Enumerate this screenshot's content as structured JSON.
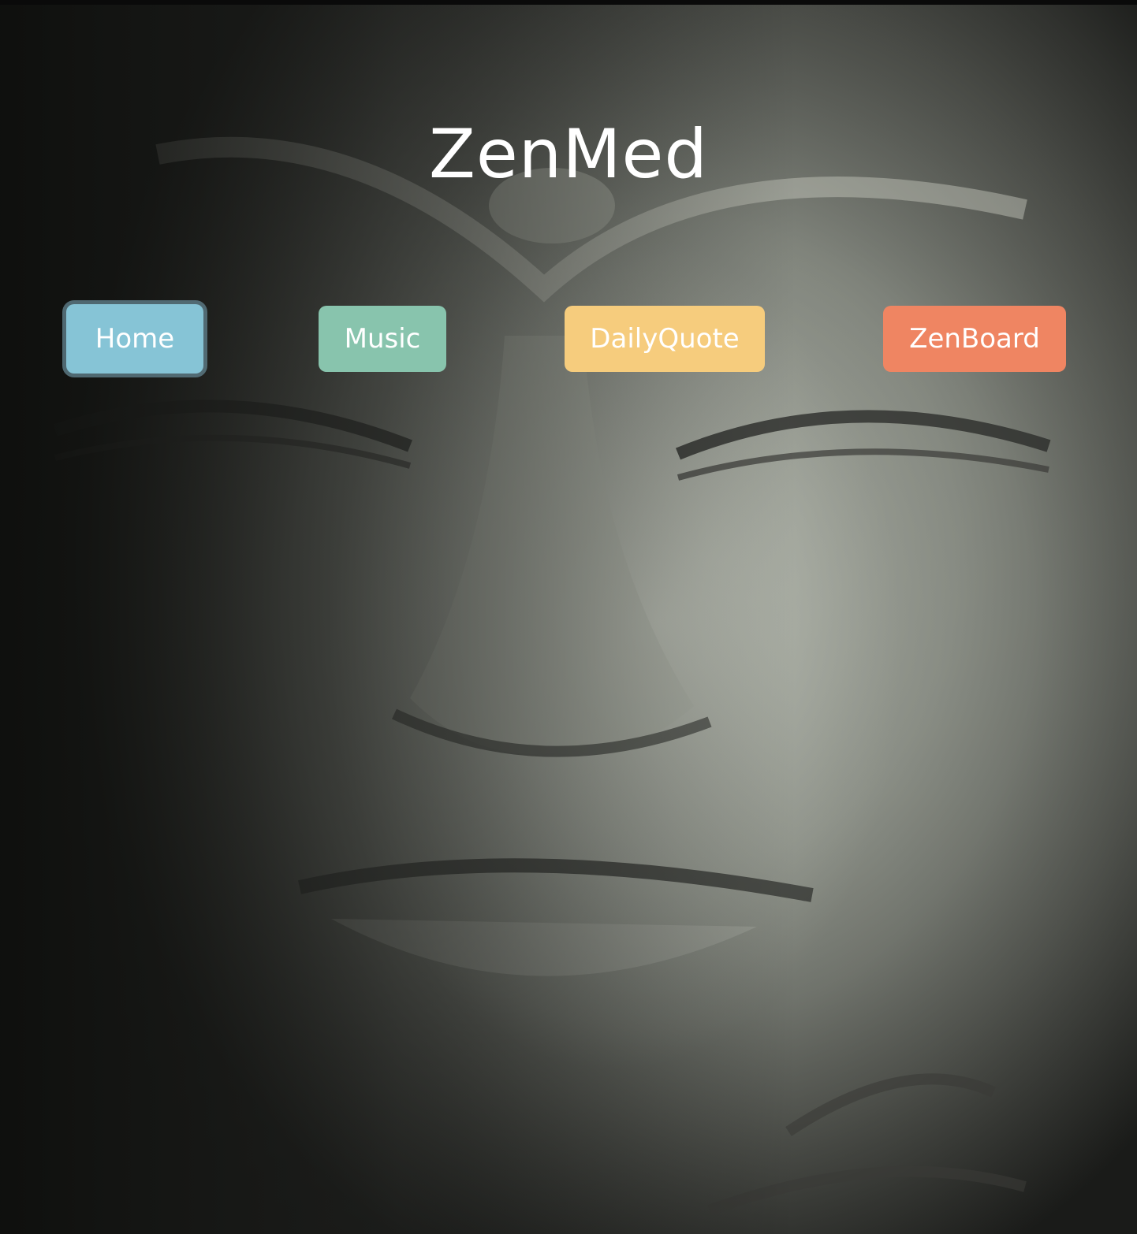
{
  "app": {
    "title": "ZenMed"
  },
  "nav": {
    "items": [
      {
        "label": "Home",
        "color": "#86c4d6",
        "focused": true
      },
      {
        "label": "Music",
        "color": "#88c4ad",
        "focused": false
      },
      {
        "label": "DailyQuote",
        "color": "#f6cc7d",
        "focused": false
      },
      {
        "label": "ZenBoard",
        "color": "#ef8562",
        "focused": false
      }
    ]
  },
  "background": {
    "subject": "stone-buddha-face-photo"
  }
}
